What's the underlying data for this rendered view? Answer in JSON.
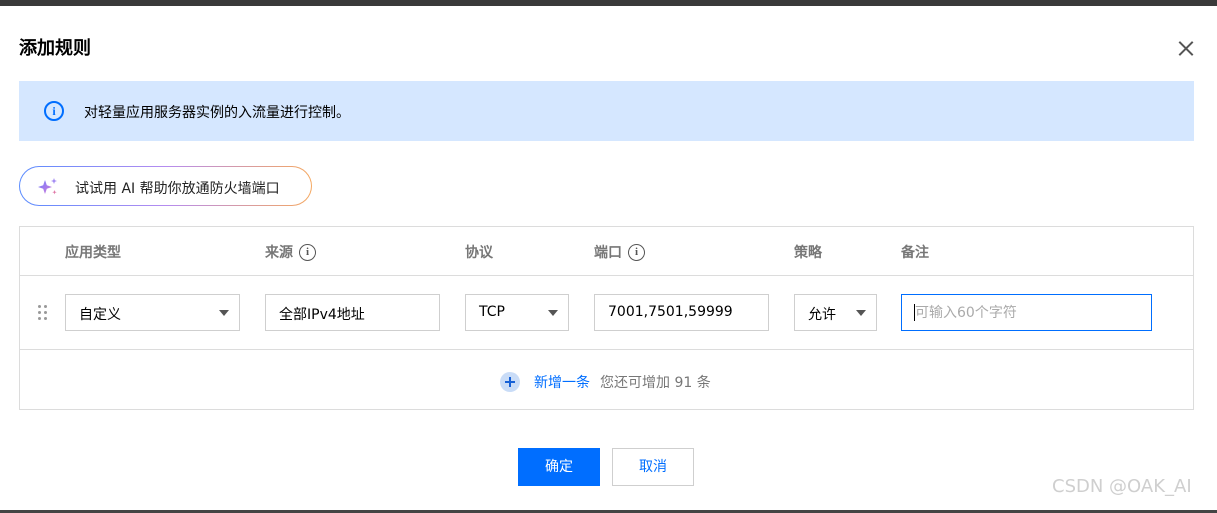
{
  "dialog": {
    "title": "添加规则",
    "info_text": "对轻量应用服务器实例的入流量进行控制。",
    "ai_button_label": "试试用 AI 帮助你放通防火墙端口"
  },
  "table": {
    "headers": {
      "app_type": "应用类型",
      "source": "来源",
      "protocol": "协议",
      "port": "端口",
      "policy": "策略",
      "note": "备注"
    },
    "row": {
      "app_type": "自定义",
      "source": "全部IPv4地址",
      "protocol": "TCP",
      "port": "7001,7501,59999",
      "policy": "允许",
      "note_value": "",
      "note_placeholder": "可输入60个字符"
    },
    "add_label": "新增一条",
    "add_hint": "您还可增加 91 条"
  },
  "footer": {
    "ok_label": "确定",
    "cancel_label": "取消"
  },
  "watermark": "CSDN @OAK_AI",
  "colors": {
    "primary": "#006eff",
    "info_bg": "#d5e7ff"
  },
  "icons": [
    "close-icon",
    "info-icon",
    "ai-sparkle-icon",
    "help-icon",
    "drag-handle-icon",
    "chevron-down-icon",
    "plus-icon"
  ]
}
